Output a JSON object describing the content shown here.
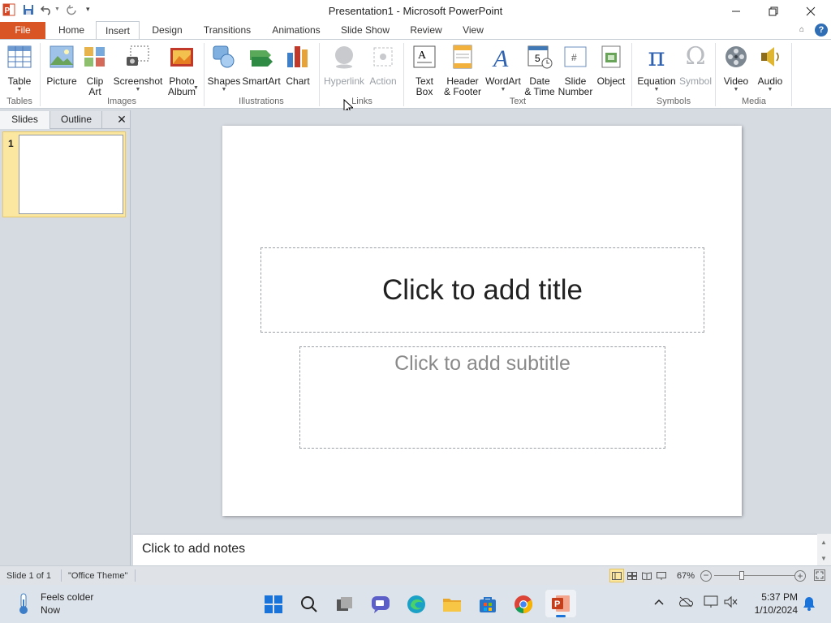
{
  "window": {
    "title": "Presentation1 - Microsoft PowerPoint",
    "minimize_icon": "minimize-icon",
    "maximize_icon": "restore-icon",
    "close_icon": "close-icon"
  },
  "quick_access": [
    "powerpoint-logo-icon",
    "save-icon",
    "undo-icon",
    "redo-icon",
    "customize-icon"
  ],
  "tabs": {
    "file": "File",
    "items": [
      "Home",
      "Insert",
      "Design",
      "Transitions",
      "Animations",
      "Slide Show",
      "Review",
      "View"
    ],
    "active": "Insert"
  },
  "ribbon": {
    "buttons": {
      "table": "Table",
      "picture": "Picture",
      "clip_art": [
        "Clip",
        "Art"
      ],
      "screenshot": "Screenshot",
      "photo_album": [
        "Photo",
        "Album"
      ],
      "shapes": "Shapes",
      "smartart": "SmartArt",
      "chart": "Chart",
      "hyperlink": "Hyperlink",
      "action": "Action",
      "text_box": [
        "Text",
        "Box"
      ],
      "header_footer": [
        "Header",
        "& Footer"
      ],
      "wordart": "WordArt",
      "date_time": [
        "Date",
        "& Time"
      ],
      "slide_number": [
        "Slide",
        "Number"
      ],
      "object": "Object",
      "equation": "Equation",
      "symbol": "Symbol",
      "video": "Video",
      "audio": "Audio"
    },
    "groups": {
      "tables": "Tables",
      "images": "Images",
      "illustrations": "Illustrations",
      "links": "Links",
      "text": "Text",
      "symbols": "Symbols",
      "media": "Media"
    }
  },
  "left_pane": {
    "tab_slides": "Slides",
    "tab_outline": "Outline",
    "close": "✕",
    "slide_number": "1"
  },
  "slide": {
    "title_placeholder": "Click to add title",
    "subtitle_placeholder": "Click to add subtitle"
  },
  "notes": {
    "placeholder": "Click to add notes"
  },
  "status": {
    "slide": "Slide 1 of 1",
    "theme": "\"Office Theme\"",
    "zoom": "67%",
    "zoom_level_pct": 67
  },
  "taskbar": {
    "weather_title": "Feels colder",
    "weather_sub": "Now",
    "time": "5:37 PM",
    "date": "1/10/2024"
  }
}
